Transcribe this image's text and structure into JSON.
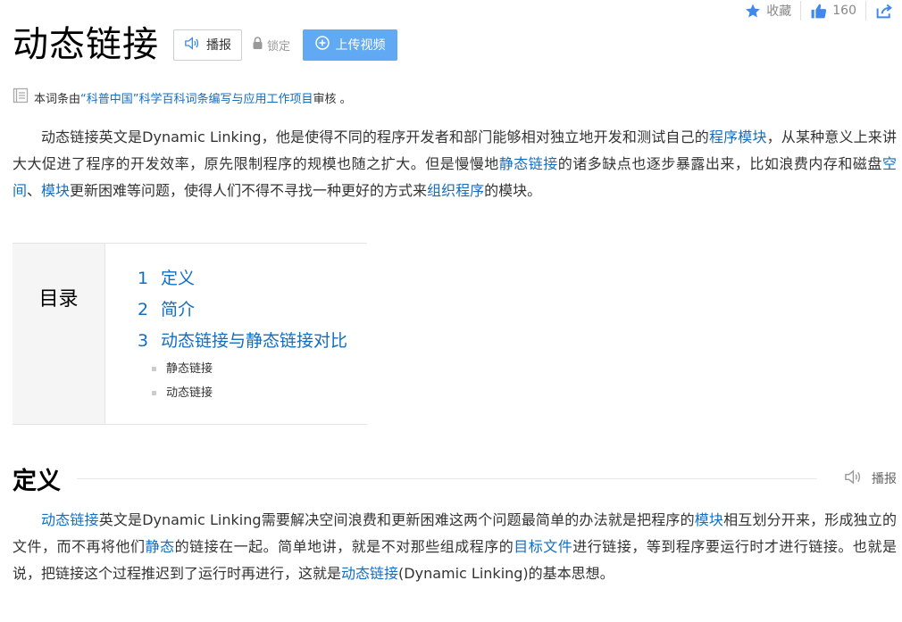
{
  "topbar": {
    "favorite_label": "收藏",
    "like_count": "160",
    "share_icon": "share-icon"
  },
  "header": {
    "title": "动态链接",
    "play_label": "播报",
    "lock_label": "锁定",
    "upload_label": "上传视频"
  },
  "review": {
    "prefix": "本词条由",
    "org": "“科普中国”科学百科词条编写与应用工作项目",
    "suffix": " 审核 。"
  },
  "intro": {
    "s1": "动态链接英文是Dynamic Linking，他是使得不同的程序开发者和部门能够相对独立地开发和测试自己的",
    "l1": "程序模块",
    "s2": "，从某种意义上来讲大大促进了程序的开发效率，原先限制程序的规模也随之扩大。但是慢慢地",
    "l2": "静态链接",
    "s3": "的诸多缺点也逐步暴露出来，比如浪费内存和磁盘",
    "l3": "空间",
    "s4": "、",
    "l4": "模块",
    "s5": "更新困难等问题，使得人们不得不寻找一种更好的方式来",
    "l5": "组织程序",
    "s6": "的模块。"
  },
  "catalog": {
    "title": "目录",
    "items": [
      {
        "index": "1",
        "label": "定义"
      },
      {
        "index": "2",
        "label": "简介"
      },
      {
        "index": "3",
        "label": "动态链接与静态链接对比"
      }
    ],
    "subitems": [
      {
        "label": "静态链接"
      },
      {
        "label": "动态链接"
      }
    ]
  },
  "section": {
    "title": "定义",
    "play_label": "播报"
  },
  "definition": {
    "l1": "动态链接",
    "s1": "英文是Dynamic Linking需要解决空间浪费和更新困难这两个问题最简单的办法就是把程序的",
    "l2": "模块",
    "s2": "相互划分开来，形成独立的文件，而不再将他们",
    "l3": "静态",
    "s3": "的链接在一起。简单地讲，就是不对那些组成程序的",
    "l4": "目标文件",
    "s4": "进行链接，等到程序要运行时才进行链接。也就是说，把链接这个过程推迟到了运行时再进行，这就是",
    "l5": "动态链接",
    "s5": "(Dynamic Linking)的基本思想。"
  },
  "colors": {
    "link": "#136ec2",
    "upload_button": "#61a9f2",
    "star": "#3f89ec"
  }
}
